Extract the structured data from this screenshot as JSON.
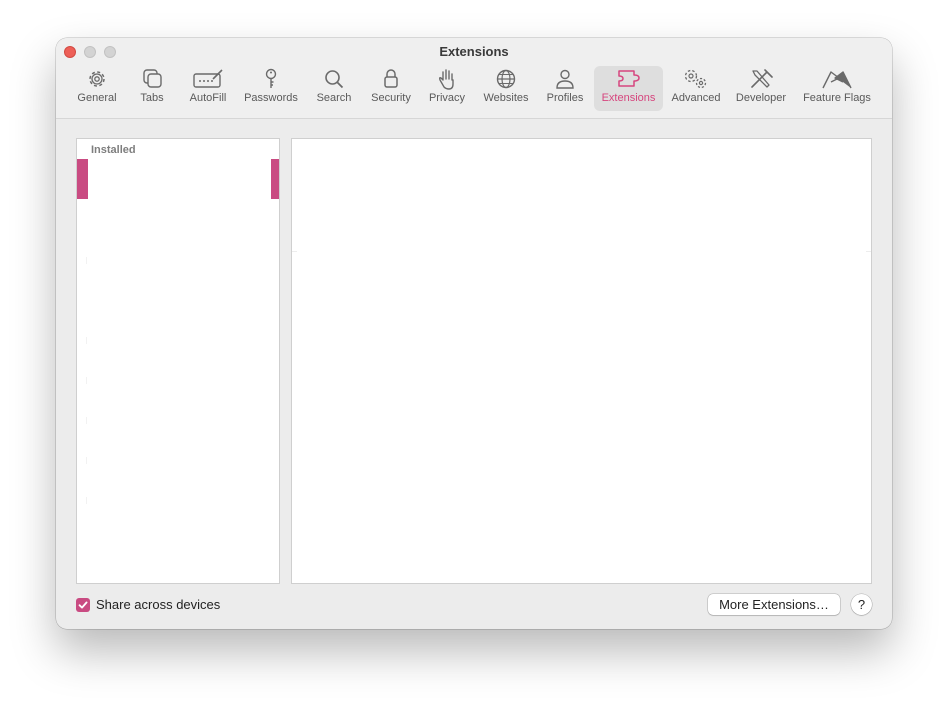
{
  "window": {
    "title": "Extensions"
  },
  "toolbar": {
    "tabs": [
      {
        "label": "General",
        "icon": "gear-icon"
      },
      {
        "label": "Tabs",
        "icon": "tabs-icon"
      },
      {
        "label": "AutoFill",
        "icon": "autofill-icon"
      },
      {
        "label": "Passwords",
        "icon": "key-icon"
      },
      {
        "label": "Search",
        "icon": "search-icon"
      },
      {
        "label": "Security",
        "icon": "lock-icon"
      },
      {
        "label": "Privacy",
        "icon": "hand-icon"
      },
      {
        "label": "Websites",
        "icon": "globe-icon"
      },
      {
        "label": "Profiles",
        "icon": "person-icon"
      },
      {
        "label": "Extensions",
        "icon": "puzzle-icon",
        "selected": true
      },
      {
        "label": "Advanced",
        "icon": "gears-icon"
      },
      {
        "label": "Developer",
        "icon": "tools-icon"
      },
      {
        "label": "Feature Flags",
        "icon": "flags-icon"
      }
    ]
  },
  "extensions_list": {
    "header": "Installed"
  },
  "footer": {
    "share_label": "Share across devices",
    "share_checked": true,
    "more_button": "More Extensions…",
    "help_button": "?"
  },
  "colors": {
    "accent": "#c94b82",
    "selected_text": "#d6457e",
    "close_button": "#ed5f57"
  }
}
